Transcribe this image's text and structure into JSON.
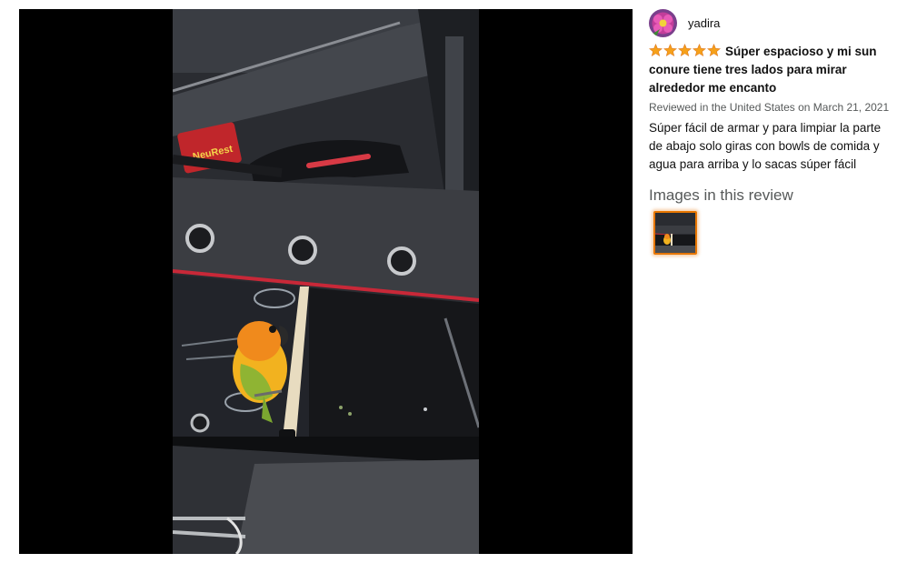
{
  "review": {
    "reviewer_name": "yadira",
    "rating": 5,
    "rating_color": "#f6a11a",
    "title": "Súper espacioso y mi sun conure tiene tres lados para mirar alrededor me encanto",
    "reviewed_meta": "Reviewed in the United States on March 21, 2021",
    "body": "Súper fácil de armar y para limpiar la parte de abajo solo giras con bowls de comida y agua para arriba y lo sacas súper fácil",
    "images_heading": "Images in this review",
    "thumbnail_count": 1,
    "thumbnail_selected_border": "#e77600"
  },
  "photo": {
    "box_label": "NeuRest"
  }
}
